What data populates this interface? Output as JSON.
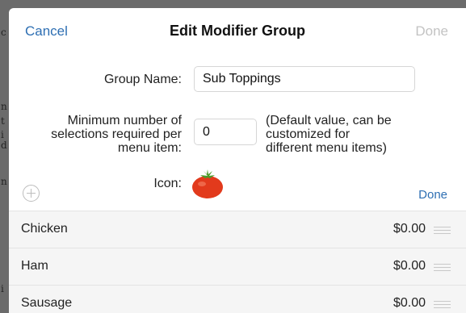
{
  "background": {
    "fragments": [
      "c",
      "n",
      "t",
      "i",
      "d",
      "n",
      "i"
    ]
  },
  "nav": {
    "cancel_label": "Cancel",
    "title": "Edit Modifier Group",
    "done_label": "Done"
  },
  "form": {
    "group_name_label": "Group Name:",
    "group_name_value": "Sub Toppings",
    "min_label_lines": [
      "Minimum number of",
      "selections required per",
      "menu item:"
    ],
    "min_value": "0",
    "min_note_lines": [
      "(Default value, can be",
      "customized for",
      "different menu items)"
    ],
    "icon_label": "Icon:",
    "icon": "tomato-icon"
  },
  "list": {
    "add_icon": "plus-circle-icon",
    "done_label": "Done",
    "items": [
      {
        "name": "Chicken",
        "price": "$0.00"
      },
      {
        "name": "Ham",
        "price": "$0.00"
      },
      {
        "name": "Sausage",
        "price": "$0.00"
      }
    ]
  },
  "colors": {
    "accent": "#2e6fb3",
    "disabled": "#c3c3c3",
    "list_background": "#f5f5f5",
    "backdrop": "#6b6b6b"
  }
}
